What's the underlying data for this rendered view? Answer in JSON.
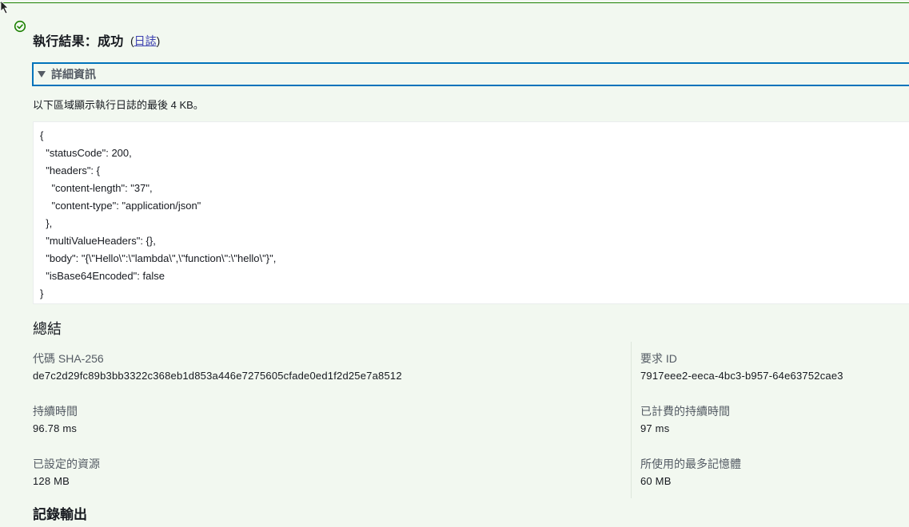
{
  "result": {
    "title": "執行結果：成功",
    "log_link_open": "(",
    "log_link_label": "日誌",
    "log_link_close": ")"
  },
  "details": {
    "toggle_label": "詳細資訊",
    "info": "以下區域顯示執行日誌的最後 4 KB。",
    "code_lines": [
      "{",
      "  \"statusCode\": 200,",
      "  \"headers\": {",
      "    \"content-length\": \"37\",",
      "    \"content-type\": \"application/json\"",
      "  },",
      "  \"multiValueHeaders\": {},",
      "  \"body\": \"{\\\"Hello\\\":\\\"lambda\\\",\\\"function\\\":\\\"hello\\\"}\",",
      "  \"isBase64Encoded\": false",
      "}"
    ]
  },
  "summary": {
    "title": "總結",
    "code_sha_label": "代碼 SHA-256",
    "code_sha_value": "de7c2d29fc89b3bb3322c368eb1d853a446e7275605cfade0ed1f2d25e7a8512",
    "request_id_label": "要求 ID",
    "request_id_value": "7917eee2-eeca-4bc3-b957-64e63752cae3",
    "duration_label": "持續時間",
    "duration_value": "96.78 ms",
    "billed_duration_label": "已計費的持續時間",
    "billed_duration_value": "97 ms",
    "resources_label": "已設定的資源",
    "resources_value": "128 MB",
    "max_memory_label": "所使用的最多記憶體",
    "max_memory_value": "60 MB"
  },
  "record_output": {
    "title": "記錄輸出"
  },
  "colors": {
    "success": "#1d8102",
    "link": "#0073bb",
    "background": "#f2f8f0"
  },
  "icons": {
    "status": "check-circle-icon",
    "toggle": "caret-down-icon"
  }
}
